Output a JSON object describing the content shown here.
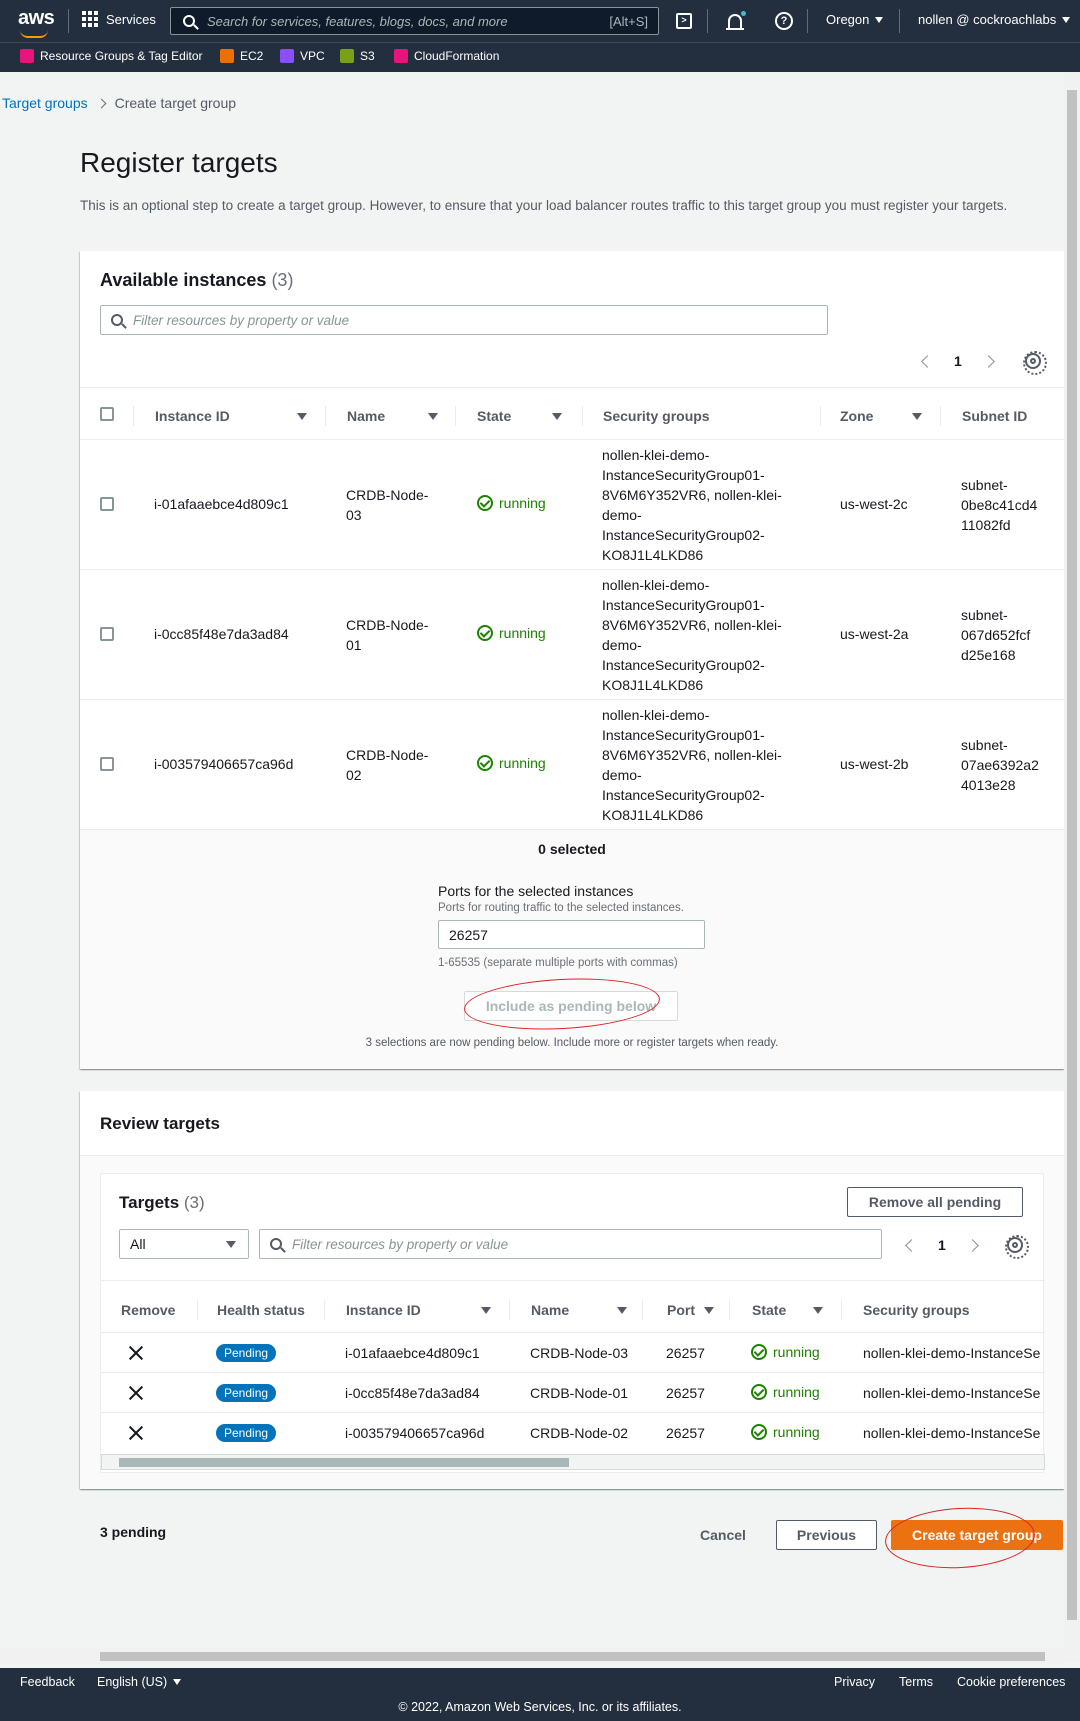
{
  "nav": {
    "logo": "aws",
    "services_label": "Services",
    "search_placeholder": "Search for services, features, blogs, docs, and more",
    "search_shortcut": "[Alt+S]",
    "region": "Oregon",
    "account": "nollen @ cockroachlabs",
    "favorites": [
      {
        "label": "Resource Groups & Tag Editor",
        "color": "#e7157b"
      },
      {
        "label": "EC2",
        "color": "#ed7100"
      },
      {
        "label": "VPC",
        "color": "#8c4fff"
      },
      {
        "label": "S3",
        "color": "#7aa116"
      },
      {
        "label": "CloudFormation",
        "color": "#e7157b"
      }
    ]
  },
  "breadcrumb": {
    "parent": "Target groups",
    "current": "Create target group"
  },
  "page": {
    "title": "Register targets",
    "description": "This is an optional step to create a target group. However, to ensure that your load balancer routes traffic to this target group you must register your targets."
  },
  "available": {
    "title": "Available instances",
    "count": "(3)",
    "filter_placeholder": "Filter resources by property or value",
    "page": "1",
    "columns": [
      "Instance ID",
      "Name",
      "State",
      "Security groups",
      "Zone",
      "Subnet ID"
    ],
    "rows": [
      {
        "instance_id": "i-01afaaebce4d809c1",
        "name_l1": "CRDB-Node-",
        "name_l2": "03",
        "state": "running",
        "sg": [
          "nollen-klei-demo-",
          "InstanceSecurityGroup01-",
          "8V6M6Y352VR6, nollen-klei-",
          "demo-",
          "InstanceSecurityGroup02-",
          "KO8J1L4LKD86"
        ],
        "zone": "us-west-2c",
        "subnet": [
          "subnet-",
          "0be8c41cd4",
          "11082fd"
        ]
      },
      {
        "instance_id": "i-0cc85f48e7da3ad84",
        "name_l1": "CRDB-Node-",
        "name_l2": "01",
        "state": "running",
        "sg": [
          "nollen-klei-demo-",
          "InstanceSecurityGroup01-",
          "8V6M6Y352VR6, nollen-klei-",
          "demo-",
          "InstanceSecurityGroup02-",
          "KO8J1L4LKD86"
        ],
        "zone": "us-west-2a",
        "subnet": [
          "subnet-",
          "067d652fcf",
          "d25e168"
        ]
      },
      {
        "instance_id": "i-003579406657ca96d",
        "name_l1": "CRDB-Node-",
        "name_l2": "02",
        "state": "running",
        "sg": [
          "nollen-klei-demo-",
          "InstanceSecurityGroup01-",
          "8V6M6Y352VR6, nollen-klei-",
          "demo-",
          "InstanceSecurityGroup02-",
          "KO8J1L4LKD86"
        ],
        "zone": "us-west-2b",
        "subnet": [
          "subnet-",
          "07ae6392a2",
          "4013e28"
        ]
      }
    ],
    "selected_text": "0 selected",
    "ports_label": "Ports for the selected instances",
    "ports_desc": "Ports for routing traffic to the selected instances.",
    "ports_value": "26257",
    "ports_hint": "1-65535 (separate multiple ports with commas)",
    "include_button": "Include as pending below",
    "pending_note": "3 selections are now pending below. Include more or register targets when ready."
  },
  "review": {
    "title": "Review targets",
    "targets_title": "Targets",
    "targets_count": "(3)",
    "remove_all": "Remove all pending",
    "filter_select": "All",
    "filter_placeholder": "Filter resources by property or value",
    "page": "1",
    "columns": [
      "Remove",
      "Health status",
      "Instance ID",
      "Name",
      "Port",
      "State",
      "Security groups"
    ],
    "rows": [
      {
        "health": "Pending",
        "instance_id": "i-01afaaebce4d809c1",
        "name": "CRDB-Node-03",
        "port": "26257",
        "state": "running",
        "sg": "nollen-klei-demo-InstanceSe"
      },
      {
        "health": "Pending",
        "instance_id": "i-0cc85f48e7da3ad84",
        "name": "CRDB-Node-01",
        "port": "26257",
        "state": "running",
        "sg": "nollen-klei-demo-InstanceSe"
      },
      {
        "health": "Pending",
        "instance_id": "i-003579406657ca96d",
        "name": "CRDB-Node-02",
        "port": "26257",
        "state": "running",
        "sg": "nollen-klei-demo-InstanceSe"
      }
    ]
  },
  "actions": {
    "pending_count": "3 pending",
    "cancel": "Cancel",
    "previous": "Previous",
    "create": "Create target group"
  },
  "footer": {
    "feedback": "Feedback",
    "language": "English (US)",
    "privacy": "Privacy",
    "terms": "Terms",
    "cookies": "Cookie preferences",
    "copyright": "© 2022, Amazon Web Services, Inc. or its affiliates."
  }
}
